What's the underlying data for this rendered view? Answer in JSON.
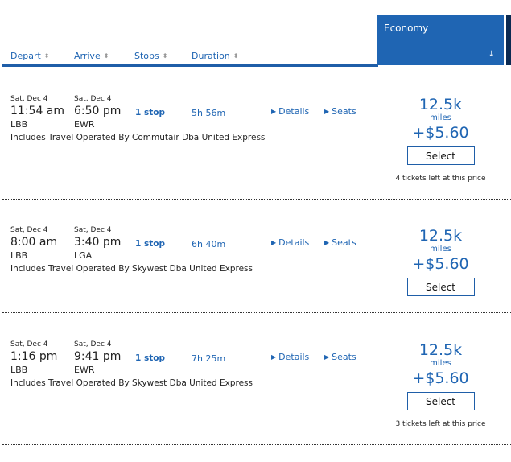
{
  "columns": {
    "depart": "Depart",
    "arrive": "Arrive",
    "stops": "Stops",
    "duration": "Duration",
    "sort_icon": "⬍"
  },
  "cabin": {
    "label": "Economy",
    "sort_icon": "↓"
  },
  "colors": {
    "accent": "#1f65b3",
    "cabin_header": "#1f65b3",
    "next_cabin": "#0b2a52"
  },
  "flights": [
    {
      "depart_date": "Sat, Dec 4",
      "depart_time": "11:54 am",
      "depart_airport": "LBB",
      "arrive_date": "Sat, Dec 4",
      "arrive_time": "6:50 pm",
      "arrive_airport": "EWR",
      "stops": "1 stop",
      "duration": "5h 56m",
      "operator": "Includes Travel Operated By Commutair Dba United Express",
      "details_label": "Details",
      "seats_label": "Seats",
      "miles": "12.5k",
      "miles_unit": "miles",
      "cash": "+$5.60",
      "select_label": "Select",
      "tickets_left": "4 tickets left at this price"
    },
    {
      "depart_date": "Sat, Dec 4",
      "depart_time": "8:00 am",
      "depart_airport": "LBB",
      "arrive_date": "Sat, Dec 4",
      "arrive_time": "3:40 pm",
      "arrive_airport": "LGA",
      "stops": "1 stop",
      "duration": "6h 40m",
      "operator": "Includes Travel Operated By Skywest Dba United Express",
      "details_label": "Details",
      "seats_label": "Seats",
      "miles": "12.5k",
      "miles_unit": "miles",
      "cash": "+$5.60",
      "select_label": "Select",
      "tickets_left": ""
    },
    {
      "depart_date": "Sat, Dec 4",
      "depart_time": "1:16 pm",
      "depart_airport": "LBB",
      "arrive_date": "Sat, Dec 4",
      "arrive_time": "9:41 pm",
      "arrive_airport": "EWR",
      "stops": "1 stop",
      "duration": "7h 25m",
      "operator": "Includes Travel Operated By Skywest Dba United Express",
      "details_label": "Details",
      "seats_label": "Seats",
      "miles": "12.5k",
      "miles_unit": "miles",
      "cash": "+$5.60",
      "select_label": "Select",
      "tickets_left": "3 tickets left at this price"
    }
  ]
}
